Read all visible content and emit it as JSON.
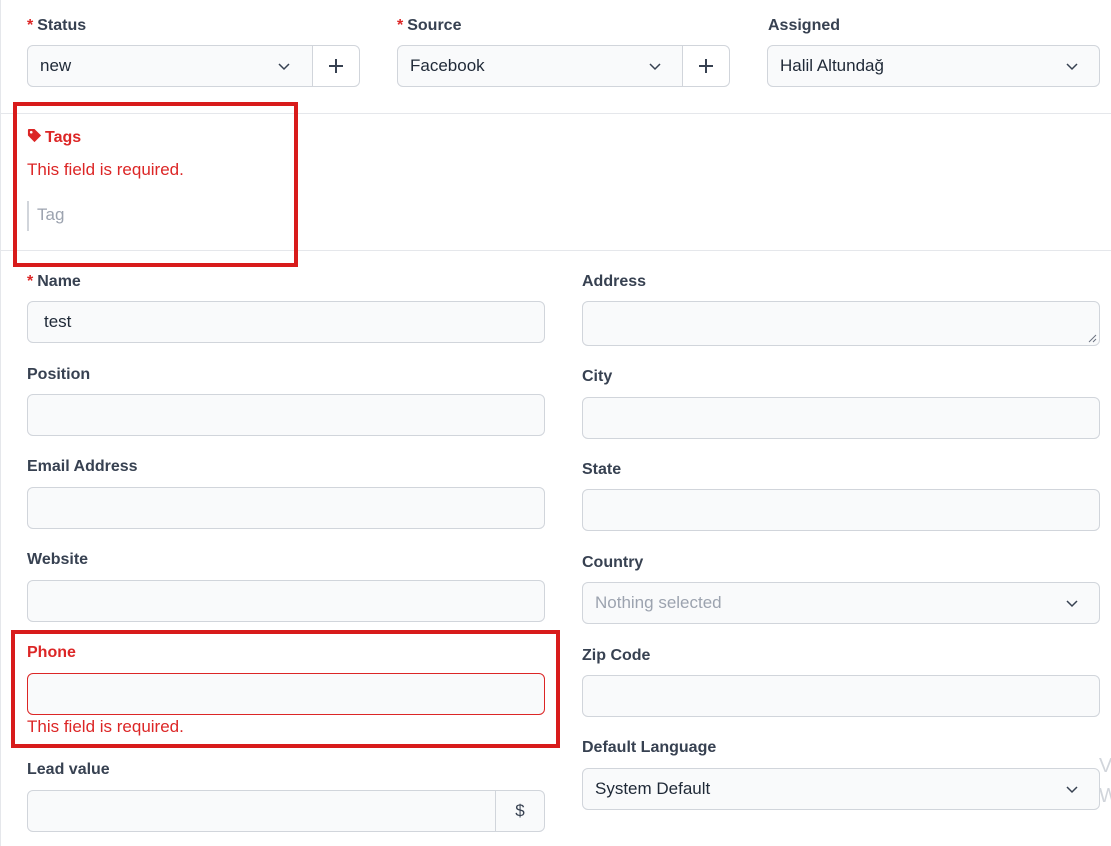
{
  "top": {
    "status": {
      "label": "Status",
      "value": "new"
    },
    "source": {
      "label": "Source",
      "value": "Facebook"
    },
    "assigned": {
      "label": "Assigned",
      "value": "Halil Altundağ"
    }
  },
  "tags": {
    "label": "Tags",
    "error": "This field is required.",
    "placeholder": "Tag"
  },
  "left": {
    "name": {
      "label": "Name",
      "value": "test"
    },
    "position": {
      "label": "Position"
    },
    "email": {
      "label": "Email Address"
    },
    "website": {
      "label": "Website"
    },
    "phone": {
      "label": "Phone",
      "error": "This field is required."
    },
    "lead_value": {
      "label": "Lead value",
      "currency": "$"
    }
  },
  "right": {
    "address": {
      "label": "Address"
    },
    "city": {
      "label": "City"
    },
    "state": {
      "label": "State"
    },
    "country": {
      "label": "Country",
      "placeholder": "Nothing selected"
    },
    "zip": {
      "label": "Zip Code"
    },
    "language": {
      "label": "Default Language",
      "value": "System Default"
    }
  },
  "edge_glyphs": [
    "V",
    "W"
  ],
  "colors": {
    "error": "#dc2626",
    "highlight_box": "#d81b1b",
    "border": "#d1d5db",
    "field_bg": "#f9fafb"
  },
  "icons": {
    "tag": "tag-icon",
    "chevron": "chevron-down-icon",
    "plus": "plus-icon"
  }
}
